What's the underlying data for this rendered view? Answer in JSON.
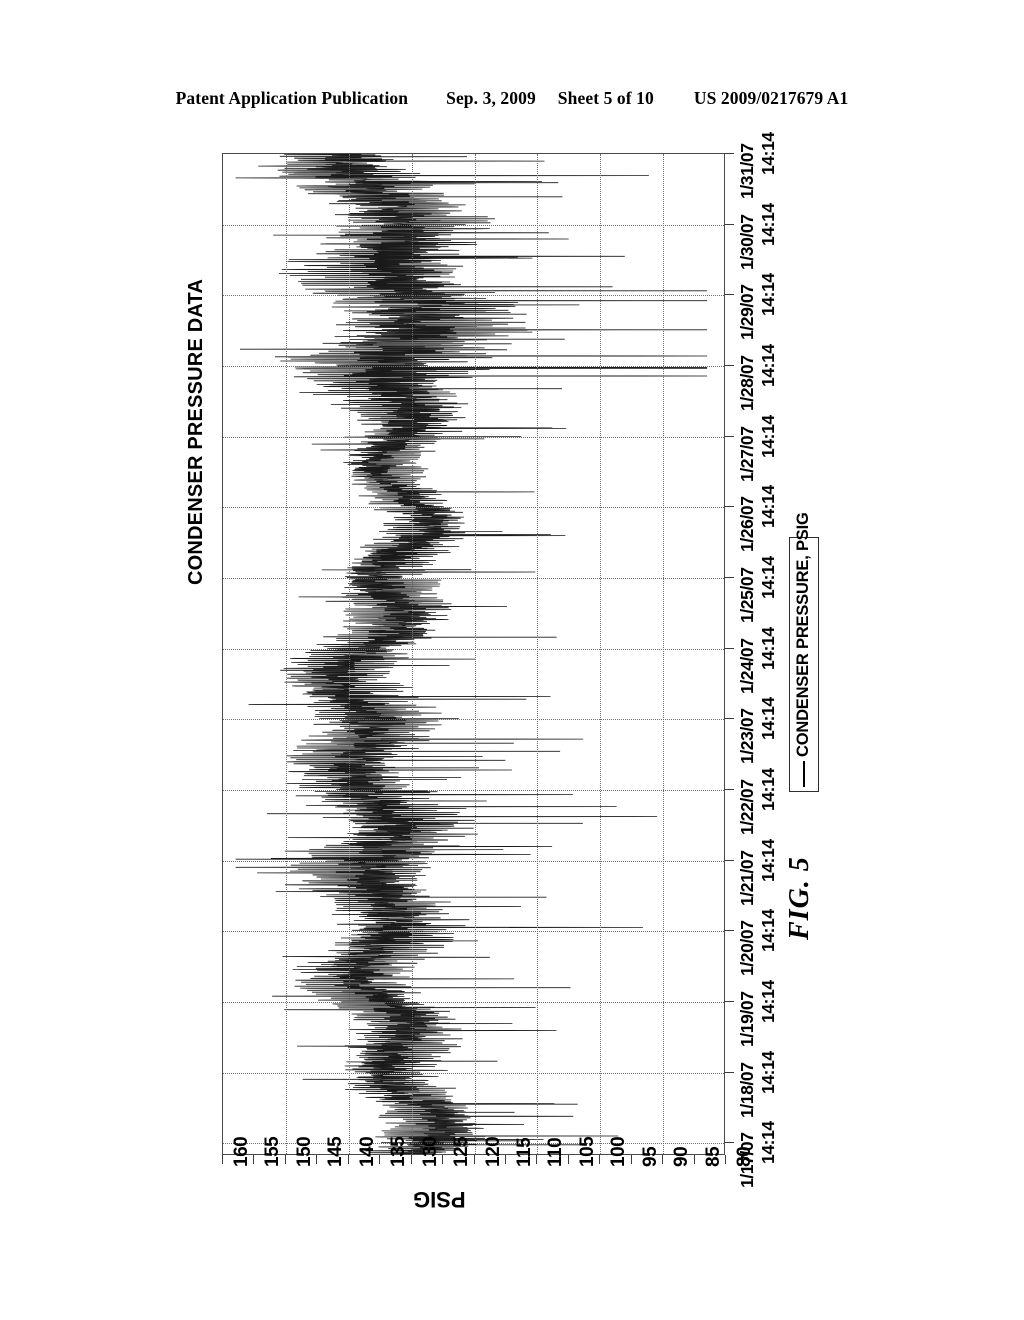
{
  "header": {
    "publication": "Patent Application Publication",
    "date": "Sep. 3, 2009",
    "sheet": "Sheet 5 of 10",
    "patent_number": "US 2009/0217679 A1"
  },
  "figure": {
    "label": "FIG. 5",
    "legend_entry": "CONDENSER PRESSURE, PSIG",
    "line_color": "#1a1a1a",
    "grid_color": "#6d6d6d",
    "frame_color": "#4a4a4a"
  },
  "chart_data": {
    "type": "line",
    "title": "CONDENSER PRESSURE DATA",
    "xlabel": "PSIG",
    "ylabel": "",
    "orientation": "rotated-90ccw",
    "grid": true,
    "legend_position": "right",
    "value_axis": {
      "name": "PSIG",
      "ticks": [
        160,
        155,
        150,
        145,
        140,
        135,
        130,
        125,
        120,
        115,
        110,
        105,
        100,
        95,
        90,
        85,
        80
      ],
      "gridline_values": [
        160,
        150,
        140,
        130,
        120,
        110,
        100,
        90,
        80
      ],
      "min": 80,
      "max": 160,
      "direction": "descending-left-to-right"
    },
    "time_axis": {
      "name": "",
      "ticks": [
        {
          "date": "1/31/07",
          "time": "14:14"
        },
        {
          "date": "1/30/07",
          "time": "14:14"
        },
        {
          "date": "1/29/07",
          "time": "14:14"
        },
        {
          "date": "1/28/07",
          "time": "14:14"
        },
        {
          "date": "1/27/07",
          "time": "14:14"
        },
        {
          "date": "1/26/07",
          "time": "14:14"
        },
        {
          "date": "1/25/07",
          "time": "14:14"
        },
        {
          "date": "1/24/07",
          "time": "14:14"
        },
        {
          "date": "1/23/07",
          "time": "14:14"
        },
        {
          "date": "1/22/07",
          "time": "14:14"
        },
        {
          "date": "1/21/07",
          "time": "14:14"
        },
        {
          "date": "1/20/07",
          "time": "14:14"
        },
        {
          "date": "1/19/07",
          "time": "14:14"
        },
        {
          "date": "1/18/07",
          "time": "14:14"
        },
        {
          "date": "1/17/07",
          "time": "14:14"
        }
      ],
      "start": "1/17/07 14:14",
      "end": "1/31/07 14:14"
    },
    "series": [
      {
        "name": "CONDENSER PRESSURE, PSIG",
        "unit": "PSIG",
        "description": "High-frequency condenser pressure trace sampled over 15 days; dense oscillating band with periodic excursions.",
        "envelope": [
          {
            "t": "1/31/07",
            "mean": 137,
            "low": 119,
            "high": 152
          },
          {
            "t": "1/30/07",
            "mean": 134,
            "low": 113,
            "high": 150
          },
          {
            "t": "1/29/07",
            "mean": 133,
            "low": 106,
            "high": 151
          },
          {
            "t": "1/28/07",
            "mean": 130,
            "low": 104,
            "high": 152
          },
          {
            "t": "1/27/07",
            "mean": 131,
            "low": 122,
            "high": 142
          },
          {
            "t": "1/26/07",
            "mean": 132,
            "low": 123,
            "high": 143
          },
          {
            "t": "1/25/07",
            "mean": 134,
            "low": 122,
            "high": 146
          },
          {
            "t": "1/24/07",
            "mean": 136,
            "low": 121,
            "high": 148
          },
          {
            "t": "1/23/07",
            "mean": 137,
            "low": 120,
            "high": 149
          },
          {
            "t": "1/22/07",
            "mean": 138,
            "low": 119,
            "high": 150
          },
          {
            "t": "1/21/07",
            "mean": 136,
            "low": 115,
            "high": 148
          },
          {
            "t": "1/20/07",
            "mean": 134,
            "low": 117,
            "high": 146
          },
          {
            "t": "1/19/07",
            "mean": 133,
            "low": 118,
            "high": 145
          },
          {
            "t": "1/18/07",
            "mean": 132,
            "low": 119,
            "high": 144
          },
          {
            "t": "1/17/07",
            "mean": 131,
            "low": 116,
            "high": 141
          }
        ]
      }
    ]
  }
}
